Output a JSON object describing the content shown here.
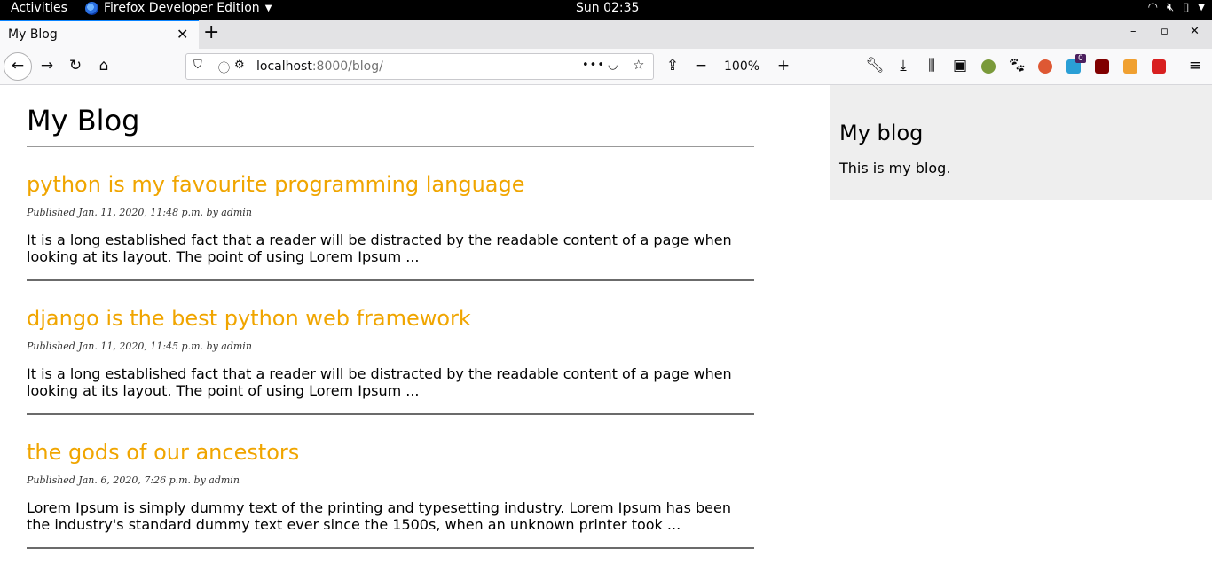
{
  "system": {
    "activities": "Activities",
    "app_name": "Firefox Developer Edition",
    "clock": "Sun 02:35"
  },
  "browser": {
    "tab_title": "My Blog",
    "url_host": "localhost",
    "url_rest": ":8000/blog/",
    "zoom": "100%",
    "notification_badge": "0"
  },
  "page": {
    "title": "My Blog",
    "posts": [
      {
        "title": "python is my favourite programming language",
        "meta": "Published Jan. 11, 2020, 11:48 p.m. by admin",
        "excerpt": "It is a long established fact that a reader will be distracted by the readable content of a page when looking at its layout. The point of using Lorem Ipsum ..."
      },
      {
        "title": "django is the best python web framework",
        "meta": "Published Jan. 11, 2020, 11:45 p.m. by admin",
        "excerpt": "It is a long established fact that a reader will be distracted by the readable content of a page when looking at its layout. The point of using Lorem Ipsum ..."
      },
      {
        "title": "the gods of our ancestors",
        "meta": "Published Jan. 6, 2020, 7:26 p.m. by admin",
        "excerpt": "Lorem Ipsum is simply dummy text of the printing and typesetting industry. Lorem Ipsum has been the industry's standard dummy text ever since the 1500s, when an unknown printer took ..."
      }
    ],
    "sidebar": {
      "heading": "My blog",
      "text": "This is my blog."
    }
  },
  "colors": {
    "post_title": "#f0a500",
    "sidebar_bg": "#eeeeee",
    "tab_accent": "#0a84ff"
  }
}
